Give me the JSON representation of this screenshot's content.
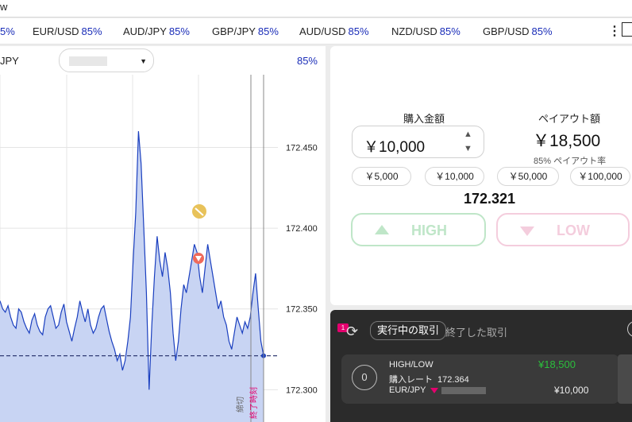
{
  "top_strip": {
    "text": "w"
  },
  "tickers": [
    {
      "pair": "",
      "pct": "5%"
    },
    {
      "pair": "EUR/USD",
      "pct": "85%"
    },
    {
      "pair": "AUD/JPY",
      "pct": "85%"
    },
    {
      "pair": "GBP/JPY",
      "pct": "85%"
    },
    {
      "pair": "AUD/USD",
      "pct": "85%"
    },
    {
      "pair": "NZD/USD",
      "pct": "85%"
    },
    {
      "pair": "GBP/USD",
      "pct": "85%"
    }
  ],
  "chart_header": {
    "pair": "JPY",
    "payout_pct": "85%"
  },
  "chart_data": {
    "type": "line",
    "y_ticks": [
      "172.450",
      "172.400",
      "172.350",
      "172.300"
    ],
    "ylim": [
      172.28,
      172.495
    ],
    "current_level": 172.321,
    "vertical_labels": [
      "締切",
      "終了時刻"
    ],
    "series": [
      {
        "values": [
          172.355,
          172.35,
          172.348,
          172.352,
          172.345,
          172.34,
          172.338,
          172.35,
          172.348,
          172.342,
          172.338,
          172.335,
          172.343,
          172.347,
          172.34,
          172.336,
          172.334,
          172.345,
          172.35,
          172.352,
          172.345,
          172.338,
          172.34,
          172.348,
          172.353,
          172.342,
          172.336,
          172.33,
          172.338,
          172.345,
          172.355,
          172.348,
          172.342,
          172.35,
          172.34,
          172.335,
          172.338,
          172.345,
          172.35,
          172.352,
          172.344,
          172.336,
          172.33,
          172.325,
          172.318,
          172.322,
          172.312,
          172.318,
          172.33,
          172.345,
          172.38,
          172.41,
          172.46,
          172.44,
          172.4,
          172.36,
          172.3,
          172.34,
          172.37,
          172.395,
          172.38,
          172.37,
          172.385,
          172.375,
          172.36,
          172.335,
          172.318,
          172.33,
          172.35,
          172.365,
          172.36,
          172.37,
          172.38,
          172.39,
          172.385,
          172.37,
          172.36,
          172.375,
          172.39,
          172.38,
          172.37,
          172.36,
          172.35,
          172.355,
          172.345,
          172.34,
          172.33,
          172.325,
          172.335,
          172.345,
          172.34,
          172.335,
          172.342,
          172.338,
          172.345,
          172.36,
          172.372,
          172.35,
          172.33,
          172.321
        ]
      }
    ]
  },
  "trade": {
    "amount_label": "購入金額",
    "amount_value": "￥10,000",
    "payout_label": "ペイアウト額",
    "payout_value": "￥18,500",
    "payout_rate": "85% ペイアウト率",
    "quick_amounts": [
      "￥5,000",
      "￥10,000",
      "￥50,000",
      "￥100,000"
    ],
    "rate": "172.321",
    "high_label": "HIGH",
    "low_label": "LOW"
  },
  "positions": {
    "badge_count": "1",
    "tab_active": "実行中の取引",
    "tab_other": "終了した取引",
    "item": {
      "index": "0",
      "type": "HIGH/LOW",
      "rate_label": "購入レート",
      "rate": "172.364",
      "pair": "EUR/JPY",
      "payout": "¥18,500",
      "stake": "¥10,000"
    }
  },
  "colors": {
    "accent_blue": "#1a2db8",
    "high_green": "#bfe6c8",
    "low_pink": "#f4cddd",
    "payout_green": "#2bbf3c",
    "badge_pink": "#e4006e"
  }
}
